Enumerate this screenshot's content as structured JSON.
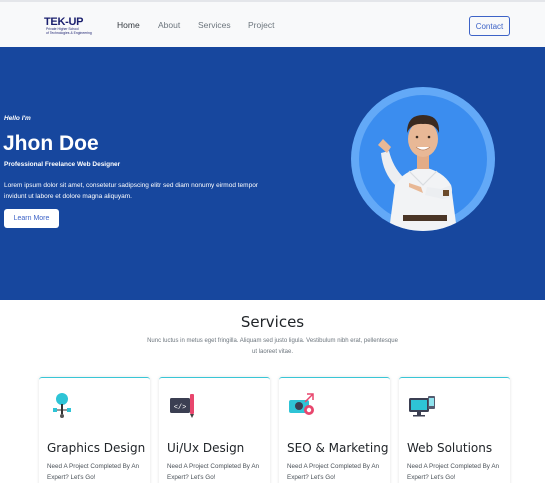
{
  "nav": {
    "logo_main": "TEK-UP",
    "logo_sub_1": "Private Higher School",
    "logo_sub_2": "of Technologies & Engineering",
    "links": [
      {
        "label": "Home",
        "active": true
      },
      {
        "label": "About"
      },
      {
        "label": "Services"
      },
      {
        "label": "Project"
      }
    ],
    "contact_label": "Contact"
  },
  "hero": {
    "greeting": "Hello I'm",
    "name": "Jhon Doe",
    "role": "Professional Freelance Web Designer",
    "description": "Lorem ipsum dolor sit amet, consetetur sadipscing elitr sed diam nonumy eirmod tempor invidunt ut labore et dolore magna aliquyam.",
    "cta_label": "Learn More",
    "background_color": "#17479e",
    "accent_circle_color": "#63a9f7"
  },
  "services": {
    "title": "Services",
    "subtitle": "Nunc luctus in metus eget fringilla. Aliquam sed justo ligula. Vestibulum nibh erat, pellentesque ut laoreet vitae.",
    "cards": [
      {
        "icon": "graphics-design-icon",
        "title": "Graphics Design",
        "text": "Need A Project Completed By An Expert? Let's Go!"
      },
      {
        "icon": "ui-ux-design-icon",
        "title": "Ui/Ux Design",
        "text": "Need A Project Completed By An Expert? Let's Go!"
      },
      {
        "icon": "seo-marketing-icon",
        "title": "SEO & Marketing",
        "text": "Need A Project Completed By An Expert? Let's Go!"
      },
      {
        "icon": "web-solutions-icon",
        "title": "Web Solutions",
        "text": "Need A Project Completed By An Expert? Let's Go!"
      }
    ],
    "card_accent_color": "#39c6d6"
  }
}
